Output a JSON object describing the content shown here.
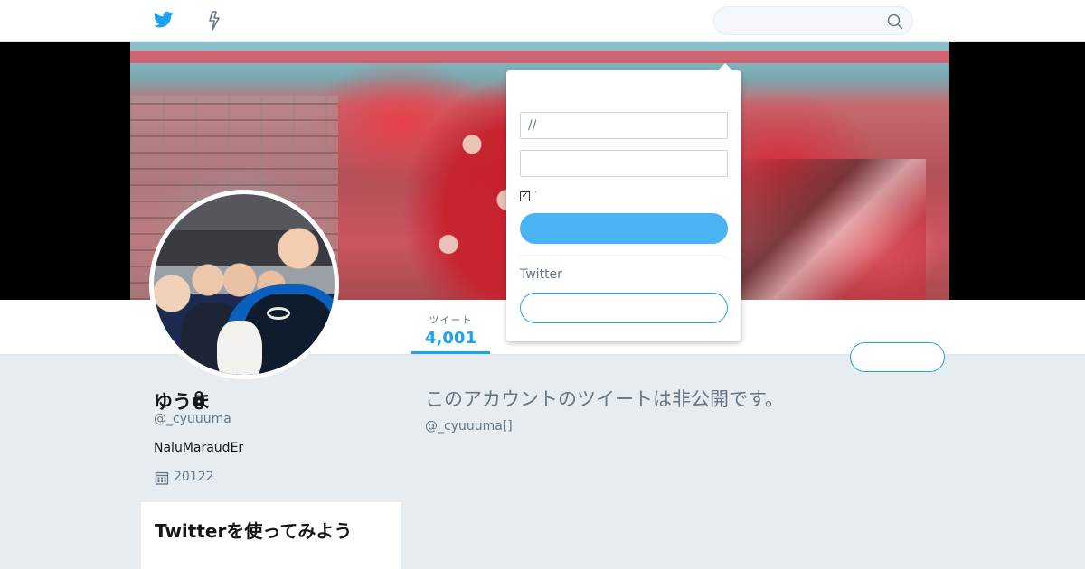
{
  "nav": {
    "search_placeholder": "",
    "home_icon": "twitter-bird-icon",
    "moments_icon": "lightning-bolt-icon",
    "search_icon": "search-icon"
  },
  "dropdown": {
    "username_value": "//",
    "password_value": "",
    "remember_checked": true,
    "remember_label": "·",
    "login_label": "",
    "signup_prompt": "Twitter",
    "signup_label": ""
  },
  "stats": {
    "tweets_label": "ツイート",
    "tweets_value": "4,001"
  },
  "follow_label": "",
  "profile": {
    "name": "ゆうま",
    "handle": "@_cyuuuma",
    "bio": "NaluMaraudEr",
    "joined": "20122",
    "locked_icon": "lock-icon",
    "calendar_icon": "calendar-icon"
  },
  "protected": {
    "title": "このアカウントのツイートは非公開です。",
    "subtitle": "@_cyuuuma[]"
  },
  "side_card": {
    "title": "Twitterを使ってみよう"
  },
  "colors": {
    "accent": "#1da1f2",
    "login_button": "#4ab3f4",
    "background": "#e6ecf0"
  }
}
